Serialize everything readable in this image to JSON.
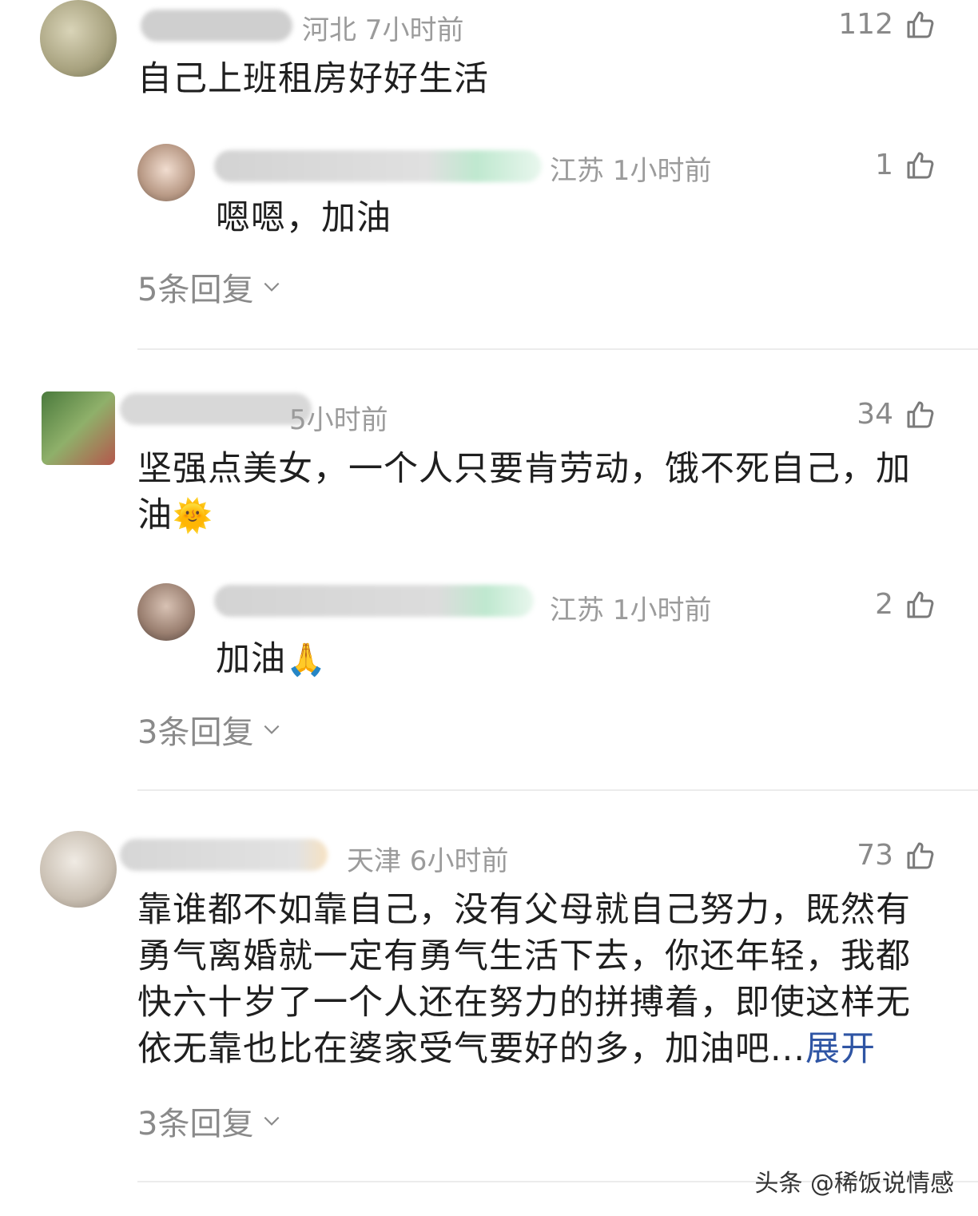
{
  "comments": [
    {
      "meta": "河北 7小时前",
      "likes": "112",
      "text": "自己上班租房好好生活",
      "reply": {
        "meta": "江苏 1小时前",
        "likes": "1",
        "text": "嗯嗯，加油"
      },
      "replies_toggle": "5条回复"
    },
    {
      "meta": "5小时前",
      "likes": "34",
      "text_line1": "坚强点美女，一个人只要肯劳动，饿不死自己，加",
      "text_line2": "油",
      "text_emoji": "🌞",
      "reply": {
        "meta": "江苏 1小时前",
        "likes": "2",
        "text": "加油",
        "emoji": "🙏"
      },
      "replies_toggle": "3条回复"
    },
    {
      "meta": "天津 6小时前",
      "likes": "73",
      "lines": [
        "靠谁都不如靠自己，没有父母就自己努力，既然有",
        "勇气离婚就一定有勇气生活下去，你还年轻，我都",
        "快六十岁了一个人还在努力的拼搏着，即使这样无",
        "依无靠也比在婆家受气要好的多，加油吧..."
      ],
      "expand": "展开",
      "replies_toggle": "3条回复"
    }
  ],
  "watermark": "头条 @稀饭说情感",
  "icons": {
    "like": "thumbs-up-icon",
    "chevron": "chevron-down-icon"
  },
  "colors": {
    "link": "#2f55a4",
    "meta": "#9b9b9b"
  }
}
